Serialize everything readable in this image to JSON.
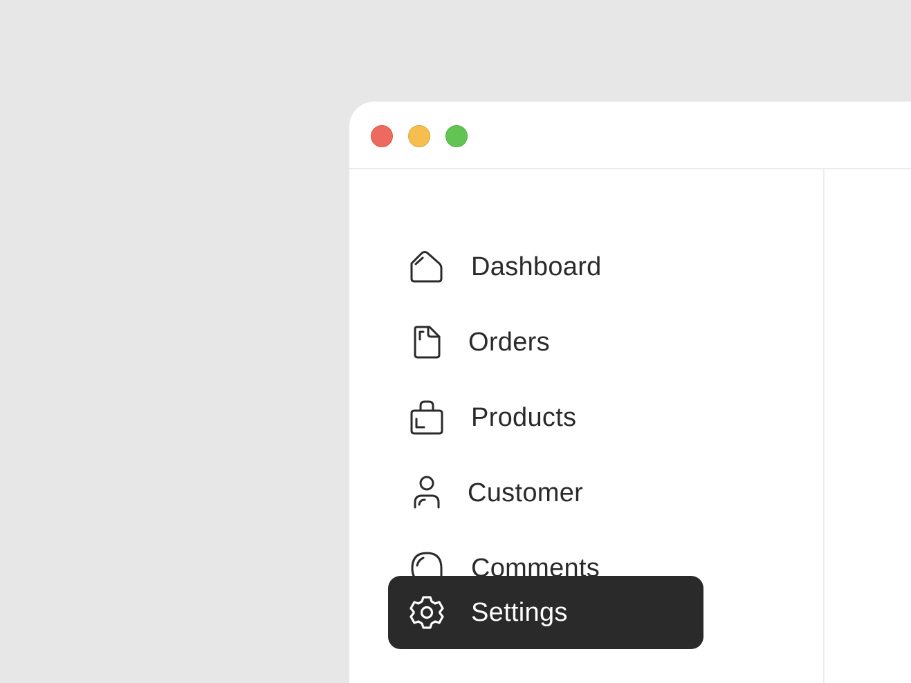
{
  "window": {
    "controls": {
      "close": "close-window",
      "minimize": "minimize-window",
      "maximize": "maximize-window"
    }
  },
  "sidebar": {
    "items": [
      {
        "label": "Dashboard",
        "icon": "home-icon",
        "active": false
      },
      {
        "label": "Orders",
        "icon": "document-icon",
        "active": false
      },
      {
        "label": "Products",
        "icon": "shopping-bag-icon",
        "active": false
      },
      {
        "label": "Customer",
        "icon": "user-icon",
        "active": false
      },
      {
        "label": "Comments",
        "icon": "chat-bubble-icon",
        "active": false
      },
      {
        "label": "Settings",
        "icon": "gear-icon",
        "active": true
      }
    ]
  },
  "colors": {
    "background": "#e7e7e7",
    "window": "#ffffff",
    "active_item": "#2a2a2a",
    "text": "#2a2a2a",
    "close": "#ee6a5f",
    "minimize": "#f5be4f",
    "maximize": "#61c554"
  }
}
